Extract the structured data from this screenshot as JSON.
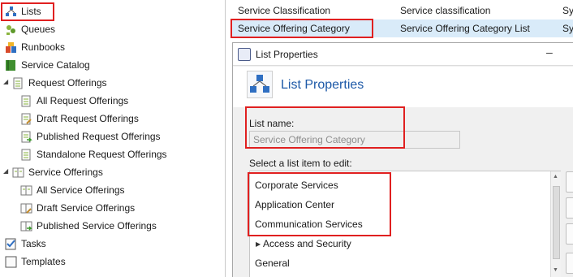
{
  "sidebar": {
    "items": [
      {
        "label": "Lists",
        "icon": "lists-icon"
      },
      {
        "label": "Queues",
        "icon": "queues-icon"
      },
      {
        "label": "Runbooks",
        "icon": "runbooks-icon"
      },
      {
        "label": "Service Catalog",
        "icon": "service-catalog-icon"
      },
      {
        "label": "Request Offerings",
        "icon": "request-offerings-icon"
      },
      {
        "label": "All Request Offerings",
        "icon": "document-icon"
      },
      {
        "label": "Draft Request Offerings",
        "icon": "draft-document-icon"
      },
      {
        "label": "Published Request Offerings",
        "icon": "published-document-icon"
      },
      {
        "label": "Standalone Request Offerings",
        "icon": "document-icon"
      },
      {
        "label": "Service Offerings",
        "icon": "service-offerings-icon"
      },
      {
        "label": "All Service Offerings",
        "icon": "offering-icon"
      },
      {
        "label": "Draft Service Offerings",
        "icon": "draft-offering-icon"
      },
      {
        "label": "Published Service Offerings",
        "icon": "published-offering-icon"
      },
      {
        "label": "Tasks",
        "icon": "tasks-icon"
      },
      {
        "label": "Templates",
        "icon": "templates-icon"
      }
    ]
  },
  "grid": {
    "rows": [
      {
        "name": "Service Classification",
        "display": "Service classification",
        "type": "Sys"
      },
      {
        "name": "Service Offering Category",
        "display": "Service Offering Category List",
        "type": "Sys"
      }
    ]
  },
  "dialog": {
    "title": "List Properties",
    "minimize_glyph": "–",
    "header_title": "List Properties",
    "list_name_label": "List name:",
    "list_name_value": "Service Offering Category",
    "select_label": "Select a list item to edit:",
    "items": [
      "Corporate Services",
      "Application Center",
      "Communication Services",
      "Access and Security",
      "General"
    ]
  },
  "colors": {
    "highlight": "#e02020",
    "accent_title": "#1e5aa8",
    "selection": "#d9ebf9"
  }
}
